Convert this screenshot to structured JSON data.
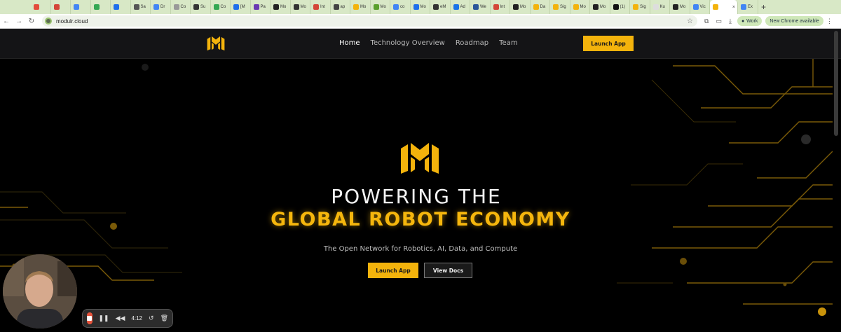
{
  "browser": {
    "tabs": [
      {
        "label": "",
        "color": "#e34b3c"
      },
      {
        "label": "",
        "color": "#d44638"
      },
      {
        "label": "",
        "color": "#4285f4"
      },
      {
        "label": "",
        "color": "#34a853"
      },
      {
        "label": "",
        "color": "#1f6feb"
      },
      {
        "label": "Sa",
        "color": "#555555"
      },
      {
        "label": "Dr",
        "color": "#4285f4"
      },
      {
        "label": "Co",
        "color": "#999999"
      },
      {
        "label": "Su",
        "color": "#333333"
      },
      {
        "label": "Co",
        "color": "#34a853"
      },
      {
        "label": "[M",
        "color": "#1f6feb"
      },
      {
        "label": "Pa",
        "color": "#6a3ab2"
      },
      {
        "label": "Mo",
        "color": "#222222"
      },
      {
        "label": "Mo",
        "color": "#333333"
      },
      {
        "label": "Int",
        "color": "#d44638"
      },
      {
        "label": "ap",
        "color": "#444444"
      },
      {
        "label": "Mo",
        "color": "#f3b30c"
      },
      {
        "label": "Mo",
        "color": "#5aa02c"
      },
      {
        "label": "co",
        "color": "#4285f4"
      },
      {
        "label": "Mo",
        "color": "#1f6feb"
      },
      {
        "label": "eM",
        "color": "#333333"
      },
      {
        "label": "Ad",
        "color": "#1a73e8"
      },
      {
        "label": "We",
        "color": "#2b579a"
      },
      {
        "label": "Int",
        "color": "#d44638"
      },
      {
        "label": "Mo",
        "color": "#222222"
      },
      {
        "label": "Da",
        "color": "#f3b30c"
      },
      {
        "label": "Sig",
        "color": "#f3b30c"
      },
      {
        "label": "Mo",
        "color": "#f3b30c"
      },
      {
        "label": "Mo",
        "color": "#222222"
      },
      {
        "label": "(1)",
        "color": "#111111"
      },
      {
        "label": "Sig",
        "color": "#f3b30c"
      },
      {
        "label": "Ku",
        "color": "#dddddd"
      },
      {
        "label": "Mo",
        "color": "#222222"
      },
      {
        "label": "Vic",
        "color": "#4285f4"
      },
      {
        "label": "",
        "color": "#f3b30c",
        "active": true
      },
      {
        "label": "Ex",
        "color": "#4285f4"
      }
    ],
    "url": "modulr.cloud",
    "profile_label": "Work",
    "update_label": "New Chrome available"
  },
  "site": {
    "nav": {
      "home": "Home",
      "technology": "Technology Overview",
      "roadmap": "Roadmap",
      "team": "Team",
      "launch": "Launch App"
    },
    "hero": {
      "title_line1": "POWERING THE",
      "title_line2": "GLOBAL ROBOT ECONOMY",
      "subtitle": "The Open Network for Robotics, AI, Data, and Compute",
      "primary_button": "Launch App",
      "secondary_button": "View Docs"
    },
    "accent_color": "#f3b30c"
  },
  "recorder": {
    "time": "4:12"
  }
}
